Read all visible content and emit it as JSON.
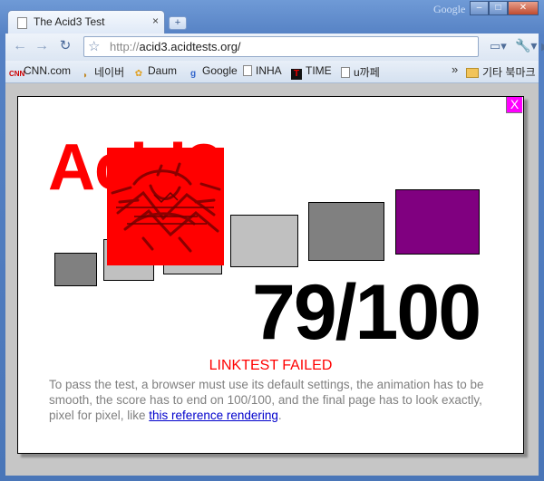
{
  "window": {
    "brand": "Google",
    "tab_title": "The Acid3 Test",
    "tab_close": "×",
    "new_tab": "+",
    "min": "–",
    "max": "□",
    "close": "✕"
  },
  "toolbar": {
    "back": "←",
    "forward": "→",
    "reload": "↻",
    "star": "☆",
    "url_scheme": "http://",
    "url_host": "acid3.acidtests.org/",
    "go": "▶",
    "page_menu": "▭▾",
    "wrench_menu": "🔧▾"
  },
  "bookmarks": {
    "items": [
      {
        "label": "CNN.com",
        "icon": "cnn-icon"
      },
      {
        "label": "네이버",
        "icon": "naver-icon"
      },
      {
        "label": "Daum",
        "icon": "daum-icon"
      },
      {
        "label": "Google",
        "icon": "google-icon"
      },
      {
        "label": "INHA",
        "icon": "page-icon"
      },
      {
        "label": "TIME",
        "icon": "time-icon"
      },
      {
        "label": "u까페",
        "icon": "page-icon"
      }
    ],
    "overflow": "»",
    "other": "기타 북마크"
  },
  "page": {
    "close_x": "X",
    "title": "Acid3",
    "score": "79/100",
    "status": "LINKTEST FAILED",
    "description": "To pass the test, a browser must use its default settings, the animation has to be smooth, the score has to end on 100/100, and the final page has to look exactly, pixel for pixel, like ",
    "link_text": "this reference rendering",
    "description_end": ".",
    "colors": {
      "red": "#ff0000",
      "purple": "#800080",
      "gray": "#808080",
      "silver": "#c0c0c0",
      "magenta": "#ff00ff"
    }
  }
}
